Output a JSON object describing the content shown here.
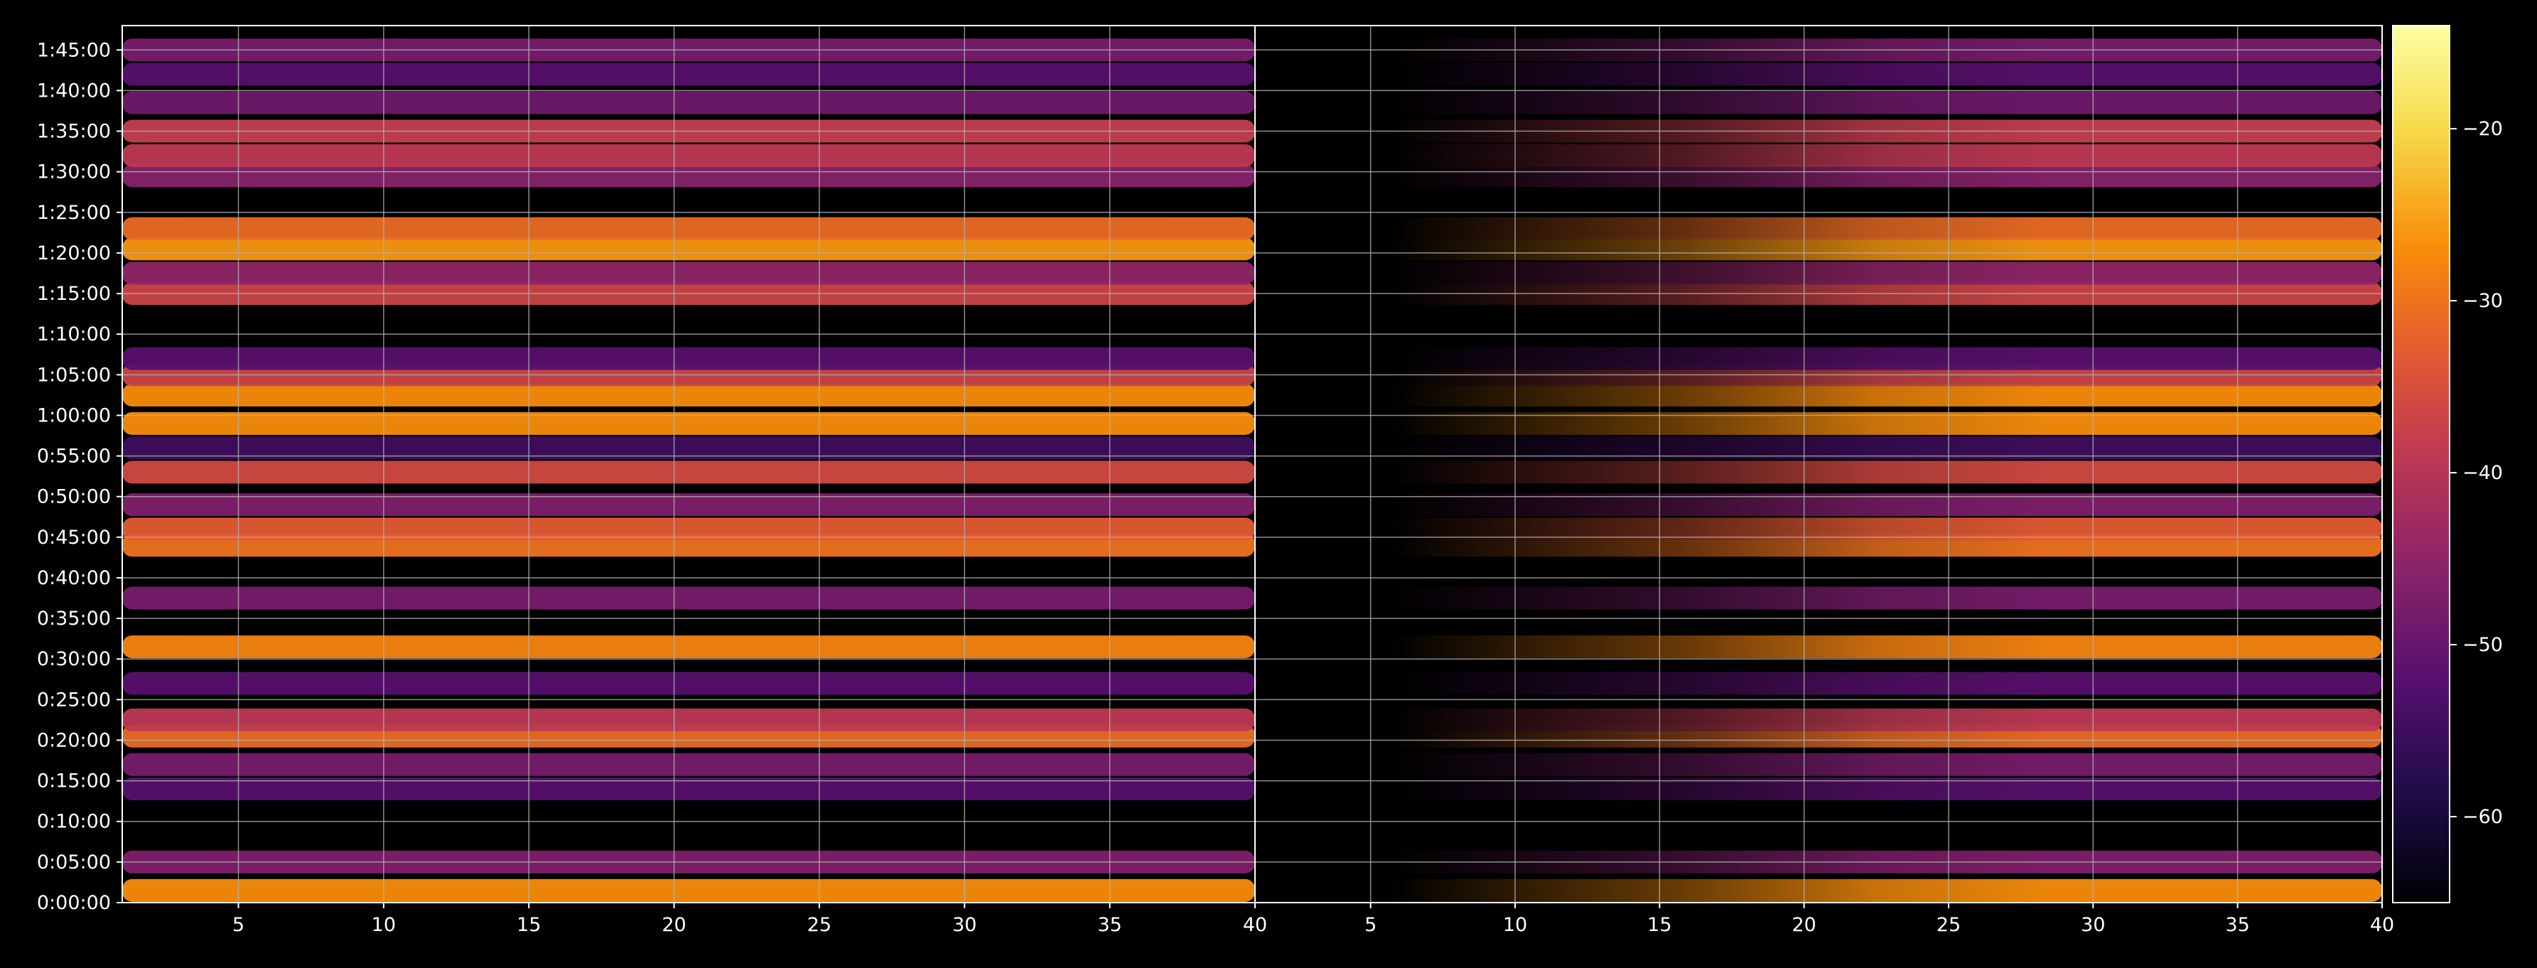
{
  "chart_data": [
    {
      "type": "heatmap",
      "title": "",
      "xlabel": "",
      "ylabel": "",
      "xlim": [
        1,
        40
      ],
      "ylim": [
        "0:00:00",
        "1:48:00"
      ],
      "xticks": [
        "5",
        "10",
        "15",
        "20",
        "25",
        "30",
        "35",
        "40"
      ],
      "yticks": [
        "0:00:00",
        "0:05:00",
        "0:10:00",
        "0:15:00",
        "0:20:00",
        "0:25:00",
        "0:30:00",
        "0:35:00",
        "0:40:00",
        "0:45:00",
        "0:50:00",
        "0:55:00",
        "1:00:00",
        "1:05:00",
        "1:10:00",
        "1:15:00",
        "1:20:00",
        "1:25:00",
        "1:30:00",
        "1:35:00",
        "1:40:00",
        "1:45:00"
      ],
      "grid": true,
      "fade_in": false,
      "rows": [
        {
          "time": "0:01:30",
          "value": -27
        },
        {
          "time": "0:05:00",
          "value": -47
        },
        {
          "time": "0:14:00",
          "value": -52
        },
        {
          "time": "0:17:00",
          "value": -48
        },
        {
          "time": "0:20:30",
          "value": -31
        },
        {
          "time": "0:22:30",
          "value": -39
        },
        {
          "time": "0:27:00",
          "value": -52
        },
        {
          "time": "0:31:30",
          "value": -28
        },
        {
          "time": "0:37:30",
          "value": -48
        },
        {
          "time": "0:44:00",
          "value": -30
        },
        {
          "time": "0:46:00",
          "value": -33
        },
        {
          "time": "0:49:00",
          "value": -47
        },
        {
          "time": "0:53:00",
          "value": -36
        },
        {
          "time": "0:56:00",
          "value": -55
        },
        {
          "time": "0:59:00",
          "value": -27
        },
        {
          "time": "1:02:30",
          "value": -27
        },
        {
          "time": "1:05:00",
          "value": -37
        },
        {
          "time": "1:07:00",
          "value": -52
        },
        {
          "time": "1:15:00",
          "value": -37
        },
        {
          "time": "1:17:30",
          "value": -45
        },
        {
          "time": "1:20:30",
          "value": -26
        },
        {
          "time": "1:23:00",
          "value": -31
        },
        {
          "time": "1:29:30",
          "value": -46
        },
        {
          "time": "1:32:00",
          "value": -39
        },
        {
          "time": "1:35:00",
          "value": -38
        },
        {
          "time": "1:38:30",
          "value": -49
        },
        {
          "time": "1:42:00",
          "value": -52
        },
        {
          "time": "1:45:00",
          "value": -48
        }
      ]
    },
    {
      "type": "heatmap",
      "title": "",
      "xlabel": "",
      "ylabel": "",
      "xlim": [
        1,
        40
      ],
      "ylim": [
        "0:00:00",
        "1:48:00"
      ],
      "xticks": [
        "5",
        "10",
        "15",
        "20",
        "25",
        "30",
        "35",
        "40"
      ],
      "yticks": [],
      "grid": true,
      "fade_in": true,
      "rows": [
        {
          "time": "0:01:30",
          "value": -27
        },
        {
          "time": "0:05:00",
          "value": -47
        },
        {
          "time": "0:14:00",
          "value": -52
        },
        {
          "time": "0:17:00",
          "value": -48
        },
        {
          "time": "0:20:30",
          "value": -31
        },
        {
          "time": "0:22:30",
          "value": -39
        },
        {
          "time": "0:27:00",
          "value": -52
        },
        {
          "time": "0:31:30",
          "value": -28
        },
        {
          "time": "0:37:30",
          "value": -48
        },
        {
          "time": "0:44:00",
          "value": -30
        },
        {
          "time": "0:46:00",
          "value": -33
        },
        {
          "time": "0:49:00",
          "value": -47
        },
        {
          "time": "0:53:00",
          "value": -36
        },
        {
          "time": "0:56:00",
          "value": -55
        },
        {
          "time": "0:59:00",
          "value": -27
        },
        {
          "time": "1:02:30",
          "value": -27
        },
        {
          "time": "1:05:00",
          "value": -37
        },
        {
          "time": "1:07:00",
          "value": -52
        },
        {
          "time": "1:15:00",
          "value": -37
        },
        {
          "time": "1:17:30",
          "value": -45
        },
        {
          "time": "1:20:30",
          "value": -26
        },
        {
          "time": "1:23:00",
          "value": -31
        },
        {
          "time": "1:29:30",
          "value": -46
        },
        {
          "time": "1:32:00",
          "value": -39
        },
        {
          "time": "1:35:00",
          "value": -38
        },
        {
          "time": "1:38:30",
          "value": -49
        },
        {
          "time": "1:42:00",
          "value": -52
        },
        {
          "time": "1:45:00",
          "value": -48
        }
      ]
    }
  ],
  "colorbar": {
    "colormap": "inferno",
    "colors": [
      "#000004",
      "#1f0c48",
      "#550f6d",
      "#88226a",
      "#ba3655",
      "#e35933",
      "#f98e09",
      "#f6d746",
      "#fcffa4"
    ],
    "range": [
      -65,
      -14
    ],
    "ticks": [
      "−20",
      "−30",
      "−40",
      "−50",
      "−60"
    ],
    "tick_values": [
      -20,
      -30,
      -40,
      -50,
      -60
    ]
  },
  "style": {
    "background": "#000000",
    "frame_color": "#ffffff",
    "grid_color": "#b0b0b0",
    "text_color": "#ffffff"
  }
}
